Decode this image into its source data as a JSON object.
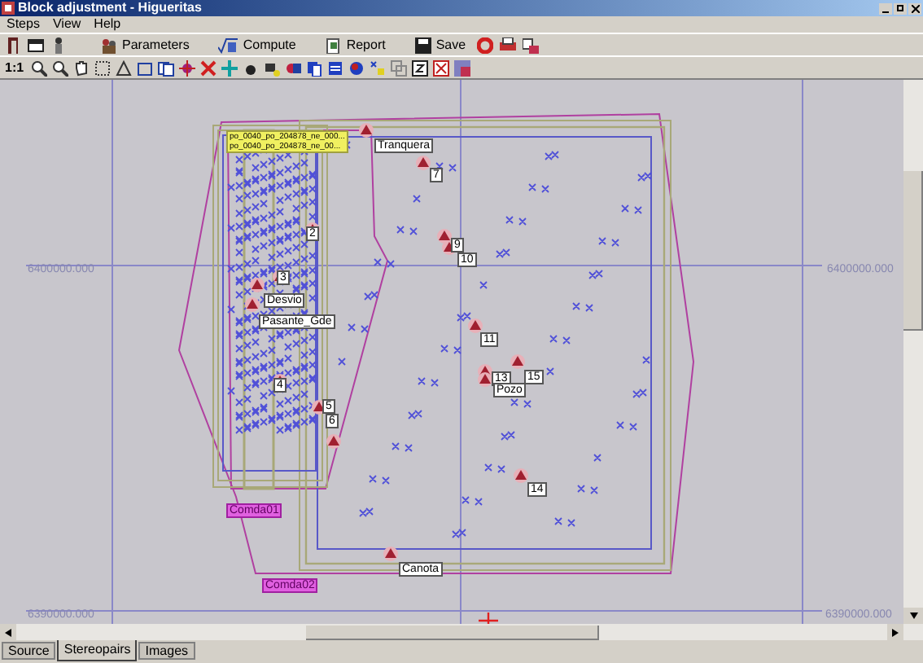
{
  "window": {
    "title": "Block adjustment - Higueritas"
  },
  "menu": [
    "Steps",
    "View",
    "Help"
  ],
  "toolbar_buttons": [
    {
      "label": "Parameters"
    },
    {
      "label": "Compute"
    },
    {
      "label": "Report"
    },
    {
      "label": "Save"
    }
  ],
  "zoom_label": "1:1",
  "map": {
    "grid_labels": [
      "6400000.000",
      "6400000.000",
      "6390000.000",
      "6390000.000"
    ],
    "footprint_label": {
      "lines": [
        "po_0040_po_204878_ne_000...",
        "po_0040_po_204878_ne_00..."
      ]
    },
    "strip_labels": [
      "Comda01",
      "Comda02"
    ],
    "points": [
      {
        "label": "Tranquera"
      },
      {
        "label": "7"
      },
      {
        "label": "9"
      },
      {
        "label": "10"
      },
      {
        "label": "11"
      },
      {
        "label": "13"
      },
      {
        "label": "Pozo"
      },
      {
        "label": "15"
      },
      {
        "label": "14"
      },
      {
        "label": "Canota"
      },
      {
        "label": "Desvio"
      },
      {
        "label": "Pasante_Gde"
      },
      {
        "label": "2"
      },
      {
        "label": "3"
      },
      {
        "label": "4"
      },
      {
        "label": "5"
      },
      {
        "label": "6"
      }
    ]
  },
  "tabs": [
    {
      "label": "Source",
      "selected": false
    },
    {
      "label": "Stereopairs",
      "selected": true
    },
    {
      "label": "Images",
      "selected": false
    }
  ]
}
